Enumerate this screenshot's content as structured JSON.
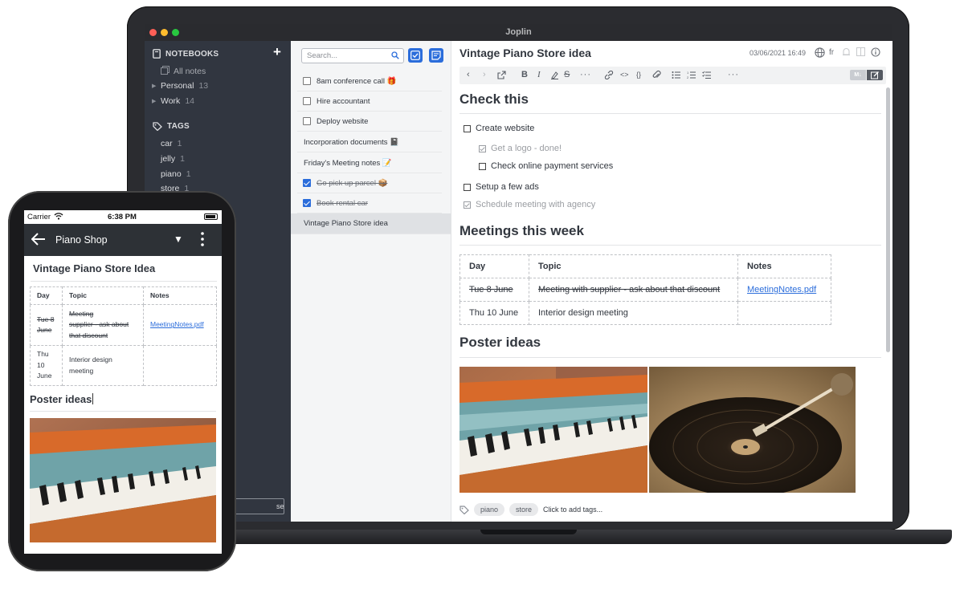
{
  "app": {
    "title": "Joplin"
  },
  "sidebar": {
    "notebooks_label": "NOTEBOOKS",
    "all_notes": "All notes",
    "notebooks": [
      {
        "name": "Personal",
        "count": "13"
      },
      {
        "name": "Work",
        "count": "14"
      }
    ],
    "tags_label": "TAGS",
    "tags": [
      "car",
      "jelly",
      "piano",
      "store"
    ],
    "sync_button_partial": "se"
  },
  "notelist": {
    "search_placeholder": "Search...",
    "notes": [
      {
        "title": "8am conference call 🎁",
        "todo": true,
        "done": false
      },
      {
        "title": "Hire accountant",
        "todo": true,
        "done": false
      },
      {
        "title": "Deploy website",
        "todo": true,
        "done": false
      },
      {
        "title": "Incorporation documents 📓",
        "todo": false
      },
      {
        "title": "Friday's Meeting notes 📝",
        "todo": false
      },
      {
        "title": "Go pick up parcel 📦",
        "todo": true,
        "done": true
      },
      {
        "title": "Book rental car",
        "todo": true,
        "done": true
      },
      {
        "title": "Vintage Piano Store idea",
        "todo": false,
        "selected": true
      }
    ]
  },
  "editor": {
    "title": "Vintage Piano Store idea",
    "date": "03/06/2021 16:49",
    "lang": "fr",
    "md_toggle_label": "M↓",
    "heading_check": "Check this",
    "todos": [
      {
        "text": "Create website",
        "done": false
      },
      {
        "text": "Get a logo - done!",
        "done": true
      },
      {
        "text": "Check online payment services",
        "done": false
      },
      {
        "text": "Setup a few ads",
        "done": false
      },
      {
        "text": "Schedule meeting with agency",
        "done": true
      }
    ],
    "heading_meetings": "Meetings this week",
    "table": {
      "headers": [
        "Day",
        "Topic",
        "Notes"
      ],
      "rows": [
        [
          "Tue 8 June",
          "Meeting with supplier - ask about that discount",
          "MeetingNotes.pdf"
        ],
        [
          "Thu 10 June",
          "Interior design meeting",
          ""
        ]
      ]
    },
    "heading_posters": "Poster ideas",
    "tags": [
      "piano",
      "store"
    ],
    "add_tags": "Click to add tags..."
  },
  "phone": {
    "carrier": "Carrier",
    "time": "6:38 PM",
    "notebook": "Piano Shop",
    "note_title": "Vintage Piano Store Idea",
    "table": {
      "headers": [
        "Day",
        "Topic",
        "Notes"
      ],
      "row1": {
        "day": [
          "Tue 8",
          "June"
        ],
        "topic": [
          "Meeting",
          "supplier - ask about",
          "that discount"
        ],
        "notes": "MeetingNotes.pdf"
      },
      "row2": {
        "day": [
          "Thu",
          "10",
          "June"
        ],
        "topic": [
          "Interior design",
          "meeting"
        ],
        "notes": ""
      }
    },
    "poster_heading": "Poster ideas"
  },
  "colors": {
    "accent": "#2b6ddb",
    "sidebar": "#313640",
    "text": "#32373f"
  }
}
